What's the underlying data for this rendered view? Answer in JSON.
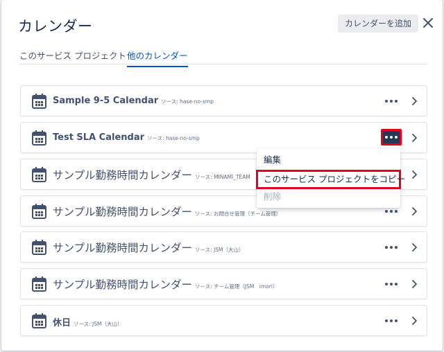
{
  "dialog": {
    "title": "カレンダー",
    "add_label": "カレンダーを追加"
  },
  "tabs": [
    {
      "label": "このサービス プロジェクト",
      "active": false
    },
    {
      "label": "他のカレンダー",
      "active": true
    }
  ],
  "calendars": [
    {
      "name": "Sample 9-5 Calendar",
      "source": "ソース: hase-no-smp"
    },
    {
      "name": "Test SLA Calendar",
      "source": "ソース: hase-no-smp"
    },
    {
      "name": "サンプル勤務時間カレンダー",
      "source": "ソース: MINAMI_TEAM"
    },
    {
      "name": "サンプル勤務時間カレンダー",
      "source": "ソース: お問合せ管理（チーム管理）"
    },
    {
      "name": "サンプル勤務時間カレンダー",
      "source": "ソース: JSM（大山）"
    },
    {
      "name": "サンプル勤務時間カレンダー",
      "source": "ソース: チーム管理（JSM　imori）"
    },
    {
      "name": "休日",
      "source": "ソース: JSM（大山）"
    }
  ],
  "menu": {
    "edit": "編集",
    "copy": "このサービス プロジェクトをコピー",
    "delete": "削除"
  },
  "colors": {
    "accent": "#0052cc",
    "highlight": "#e5001c",
    "icon": "#42526e"
  },
  "icons": {
    "calendar": "calendar-icon",
    "more": "more-icon",
    "chevron": "chevron-right-icon",
    "close": "close-icon"
  }
}
